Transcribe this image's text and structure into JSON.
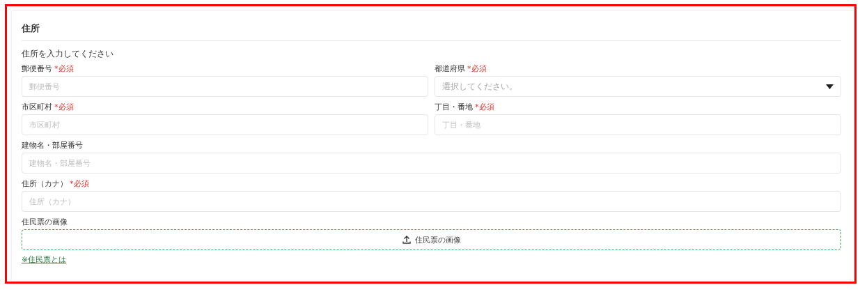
{
  "section": {
    "title": "住所",
    "description": "住所を入力してください"
  },
  "fields": [
    {
      "kind": "text",
      "wide": false,
      "label": "郵便番号",
      "required_mark": "*必須",
      "placeholder": "郵便番号"
    },
    {
      "kind": "select",
      "wide": false,
      "label": "都道府県",
      "required_mark": "*必須",
      "placeholder": "選択してください。"
    },
    {
      "kind": "text",
      "wide": false,
      "label": "市区町村",
      "required_mark": "*必須",
      "placeholder": "市区町村"
    },
    {
      "kind": "text",
      "wide": false,
      "label": "丁目・番地",
      "required_mark": "*必須",
      "placeholder": "丁目・番地"
    },
    {
      "kind": "text",
      "wide": true,
      "label": "建物名・部屋番号",
      "placeholder": "建物名・部屋番号"
    },
    {
      "kind": "text",
      "wide": true,
      "label": "住所（カナ）",
      "required_mark": "*必須",
      "placeholder": "住所（カナ）"
    },
    {
      "kind": "upload",
      "wide": true,
      "label": "住民票の画像",
      "button": "住民票の画像"
    }
  ],
  "help_link": "※住民票とは"
}
